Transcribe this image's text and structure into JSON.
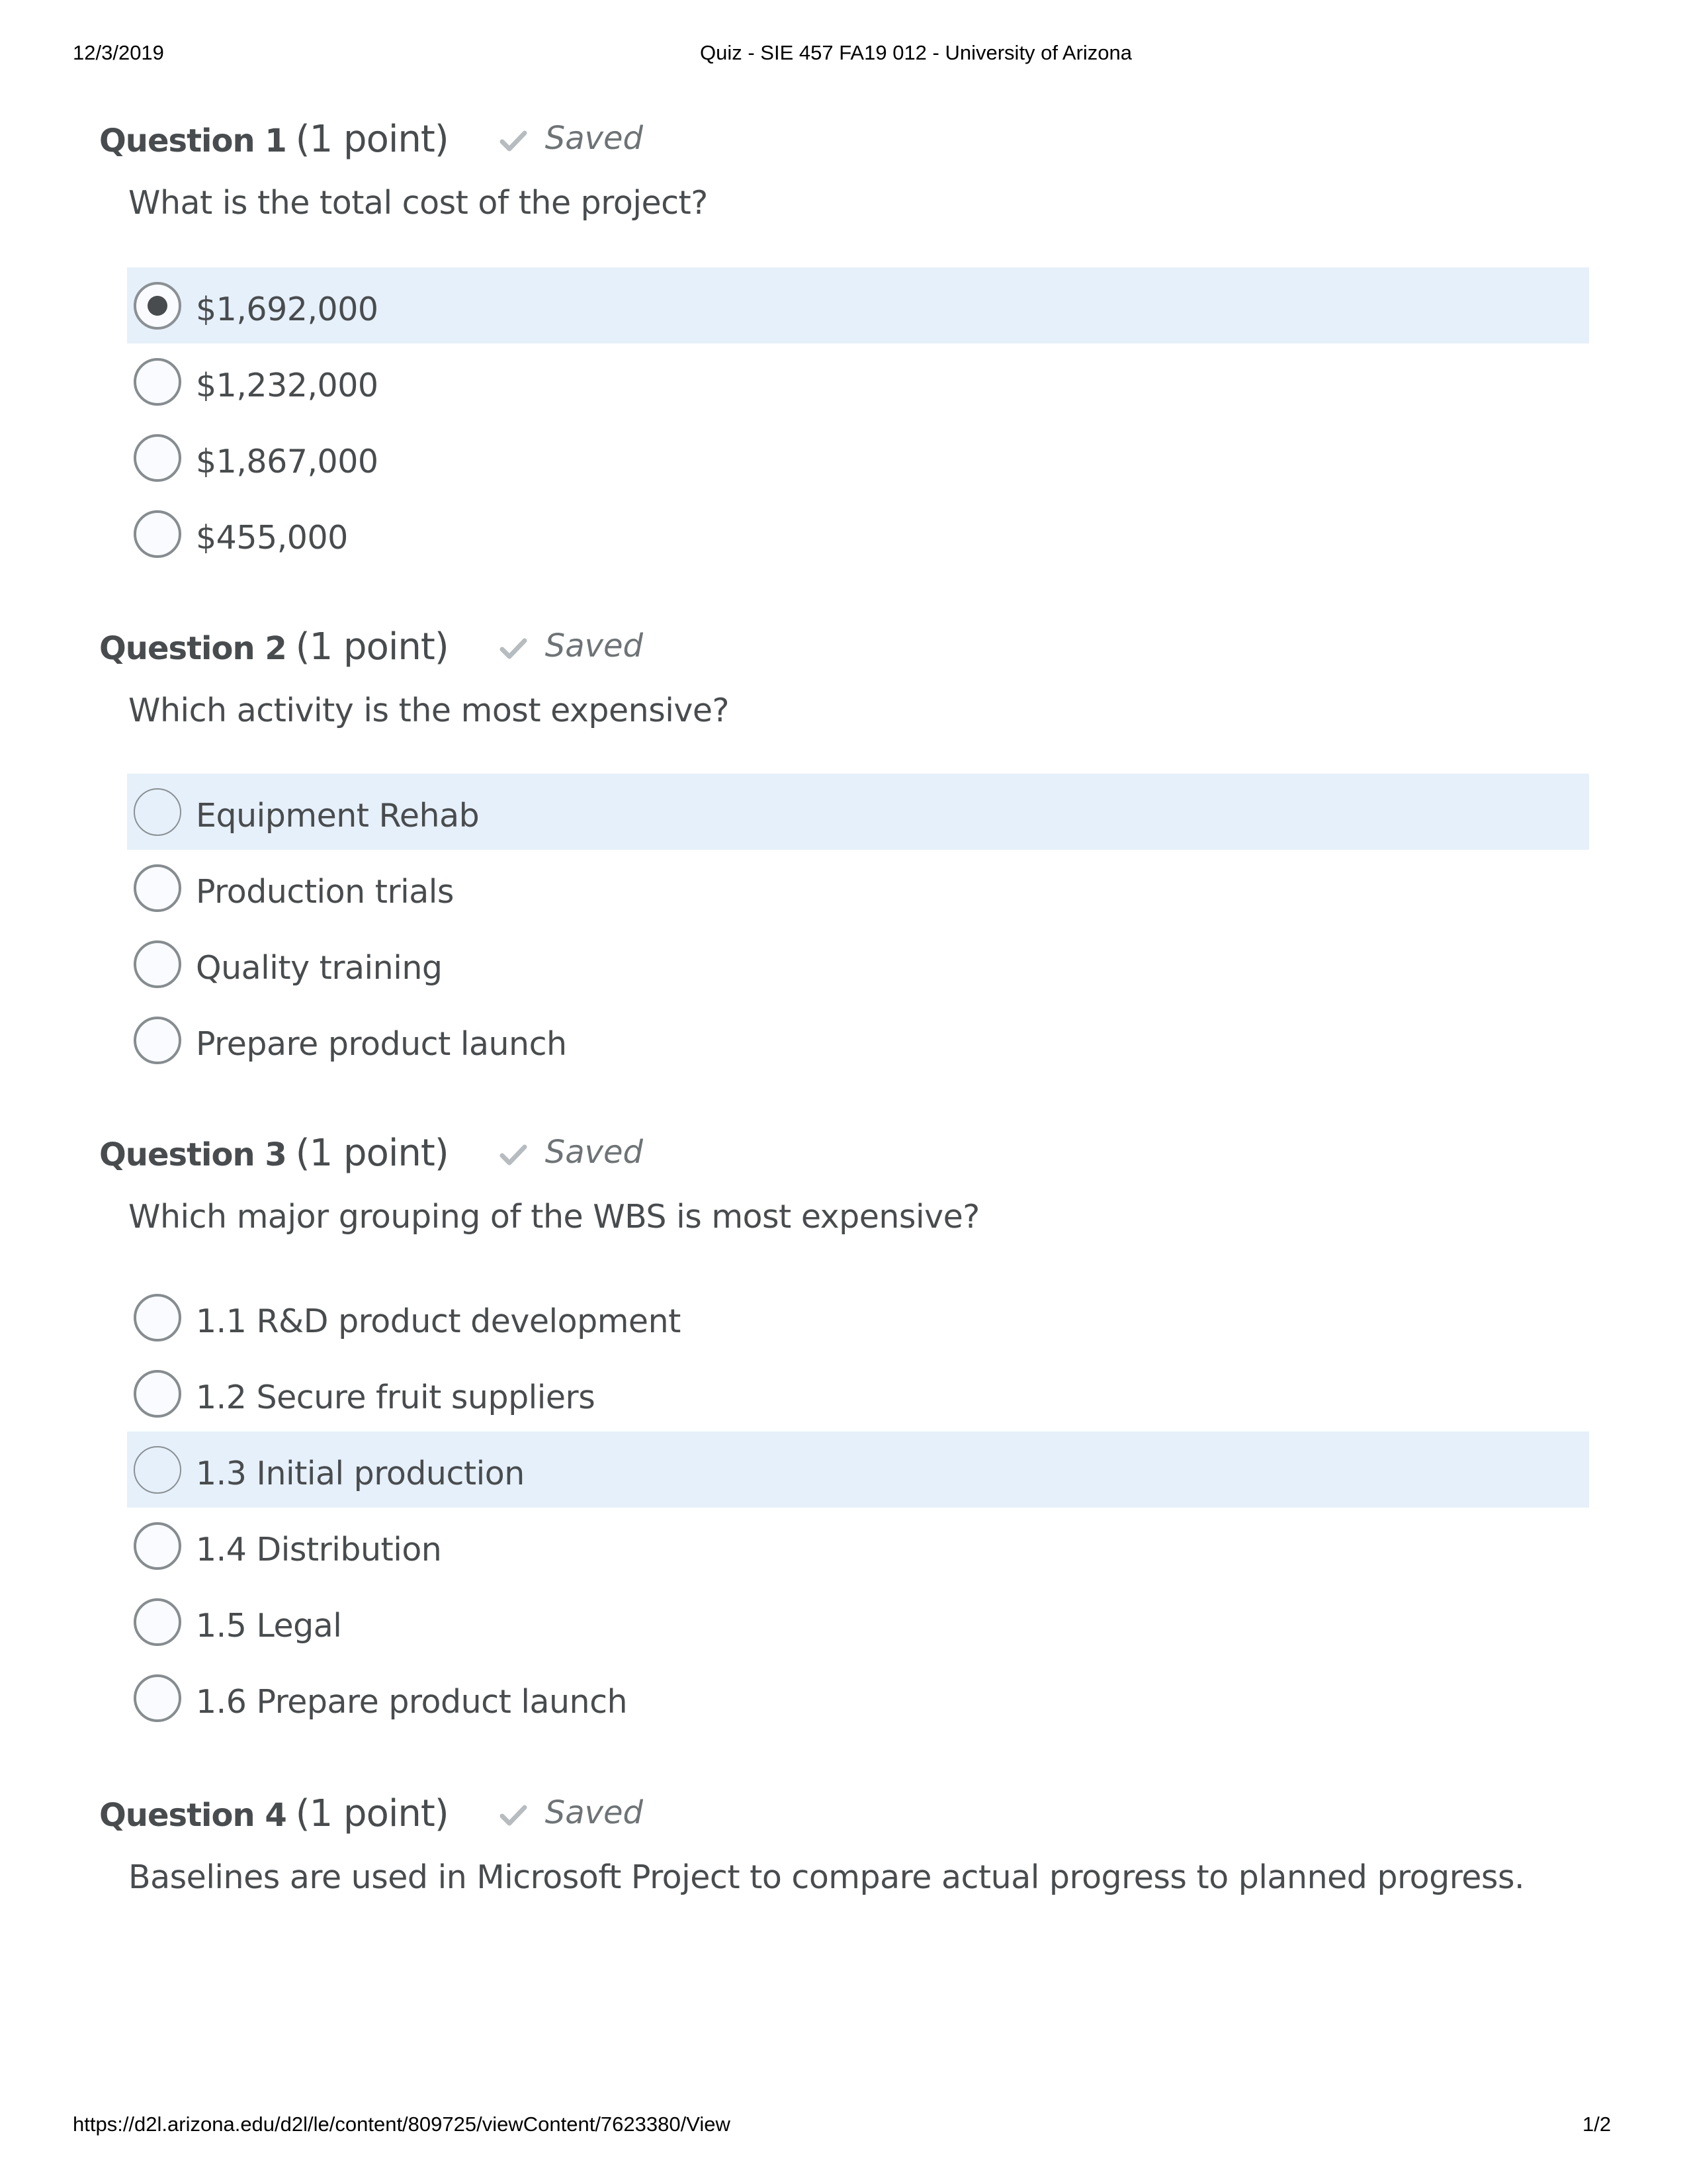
{
  "print_header": {
    "date": "12/3/2019",
    "title": "Quiz - SIE 457 FA19 012 - University of Arizona"
  },
  "print_footer": {
    "url": "https://d2l.arizona.edu/d2l/le/content/809725/viewContent/7623380/View",
    "page": "1/2"
  },
  "colors": {
    "text": "#494c4e",
    "saved_text": "#6e7376",
    "check": "#b6bcbf",
    "highlight": "#e6f0fa",
    "radio_border": "#868c8f"
  },
  "questions": [
    {
      "number_label": "Question 1",
      "points_label": "(1 point)",
      "status_icon": "check-icon",
      "status_label": "Saved",
      "text": "What is the total cost of the project?",
      "options": [
        {
          "label": "$1,692,000",
          "selected": true,
          "highlighted": true
        },
        {
          "label": "$1,232,000",
          "selected": false,
          "highlighted": false
        },
        {
          "label": "$1,867,000",
          "selected": false,
          "highlighted": false
        },
        {
          "label": "$455,000",
          "selected": false,
          "highlighted": false
        }
      ]
    },
    {
      "number_label": "Question 2",
      "points_label": "(1 point)",
      "status_icon": "check-icon",
      "status_label": "Saved",
      "text": "Which activity is the most expensive?",
      "options": [
        {
          "label": "Equipment Rehab",
          "selected": false,
          "highlighted": true
        },
        {
          "label": "Production trials",
          "selected": false,
          "highlighted": false
        },
        {
          "label": "Quality training",
          "selected": false,
          "highlighted": false
        },
        {
          "label": "Prepare product launch",
          "selected": false,
          "highlighted": false
        }
      ]
    },
    {
      "number_label": "Question 3",
      "points_label": "(1 point)",
      "status_icon": "check-icon",
      "status_label": "Saved",
      "text": "Which major grouping of the WBS is most expensive?",
      "options": [
        {
          "label": "1.1 R&D product development",
          "selected": false,
          "highlighted": false
        },
        {
          "label": "1.2 Secure fruit suppliers",
          "selected": false,
          "highlighted": false
        },
        {
          "label": "1.3 Initial production",
          "selected": false,
          "highlighted": true
        },
        {
          "label": "1.4 Distribution",
          "selected": false,
          "highlighted": false
        },
        {
          "label": "1.5 Legal",
          "selected": false,
          "highlighted": false
        },
        {
          "label": "1.6 Prepare product launch",
          "selected": false,
          "highlighted": false
        }
      ]
    },
    {
      "number_label": "Question 4",
      "points_label": "(1 point)",
      "status_icon": "check-icon",
      "status_label": "Saved",
      "text": "Baselines are used in Microsoft Project to compare actual progress to planned progress.",
      "options": []
    }
  ]
}
